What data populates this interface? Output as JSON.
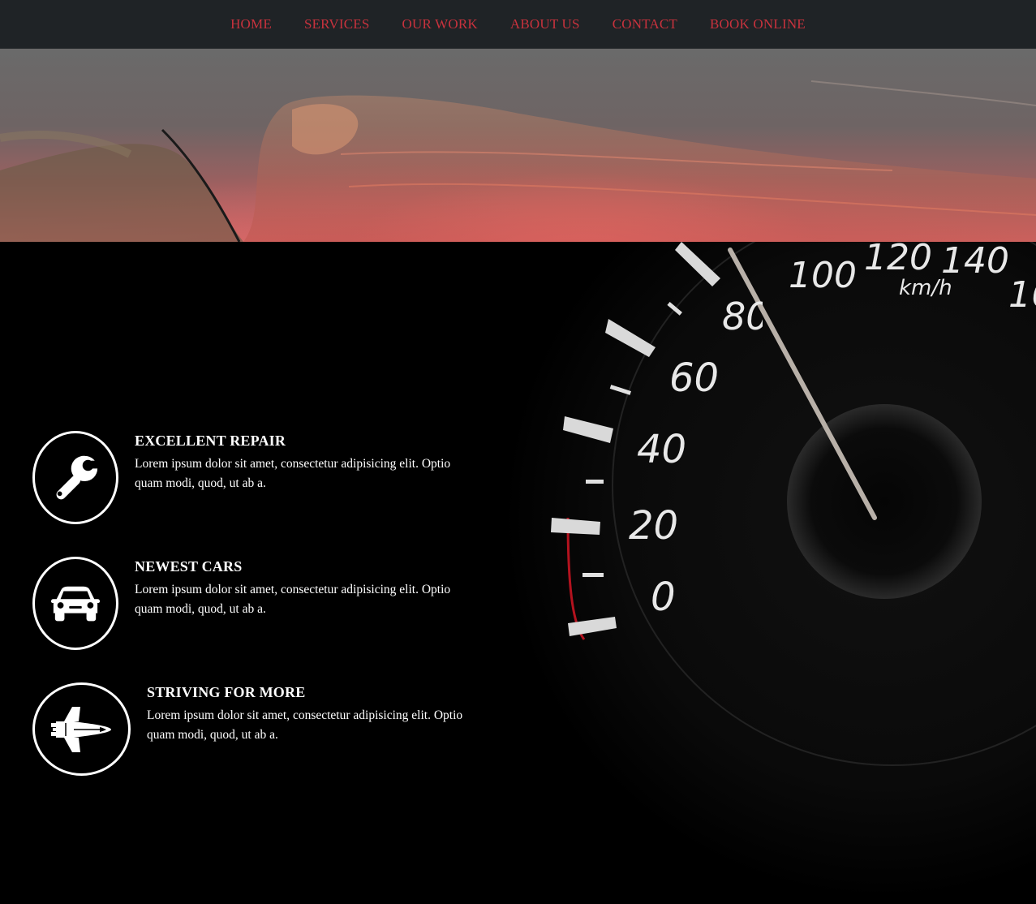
{
  "nav": {
    "items": [
      {
        "label": "HOME"
      },
      {
        "label": "SERVICES"
      },
      {
        "label": "OUR WORK"
      },
      {
        "label": "ABOUT US"
      },
      {
        "label": "CONTACT"
      },
      {
        "label": "BOOK ONLINE"
      }
    ],
    "color": "#c8323d"
  },
  "gauge": {
    "numbers": [
      "0",
      "20",
      "40",
      "60",
      "80",
      "100",
      "120",
      "140",
      "16"
    ],
    "unit": "km/h"
  },
  "features": [
    {
      "icon": "wrench-icon",
      "title": "EXCELLENT REPAIR",
      "description": "Lorem ipsum dolor sit amet, consectetur adipisicing elit. Optio quam modi, quod, ut ab a."
    },
    {
      "icon": "car-icon",
      "title": "NEWEST CARS",
      "description": "Lorem ipsum dolor sit amet, consectetur adipisicing elit. Optio quam modi, quod, ut ab a."
    },
    {
      "icon": "space-shuttle-icon",
      "title": "STRIVING FOR MORE",
      "description": "Lorem ipsum dolor sit amet, consectetur adipisicing elit. Optio quam modi, quod, ut ab a."
    }
  ]
}
